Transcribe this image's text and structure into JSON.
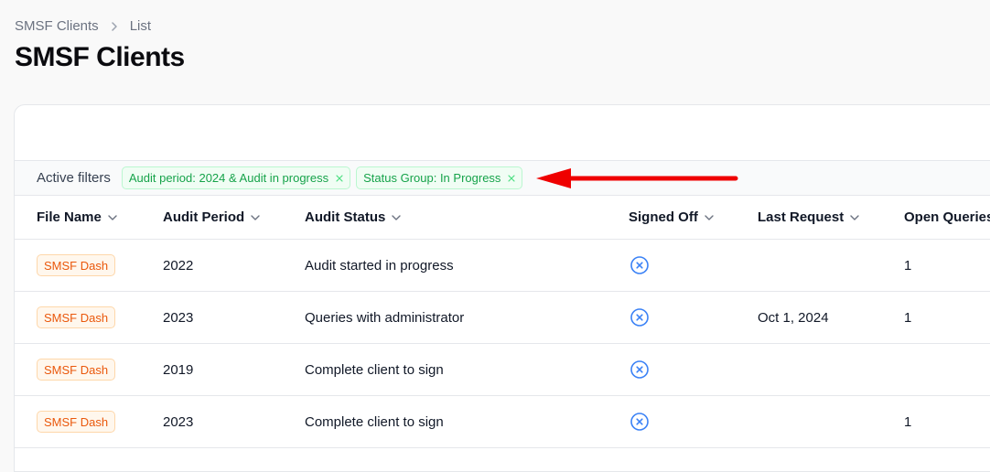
{
  "breadcrumb": {
    "parent": "SMSF Clients",
    "current": "List"
  },
  "page_title": "SMSF Clients",
  "filters": {
    "label": "Active filters",
    "chips": [
      {
        "label": "Audit period: 2024 & Audit in progress"
      },
      {
        "label": "Status Group: In Progress"
      }
    ]
  },
  "table": {
    "columns": [
      "File Name",
      "Audit Period",
      "Audit Status",
      "Signed Off",
      "Last Request",
      "Open Queries"
    ],
    "rows": [
      {
        "file": "SMSF Dash",
        "period": "2022",
        "status": "Audit started in progress",
        "last_request": "",
        "open_queries": "1"
      },
      {
        "file": "SMSF Dash",
        "period": "2023",
        "status": "Queries with administrator",
        "last_request": "Oct 1, 2024",
        "open_queries": "1"
      },
      {
        "file": "SMSF Dash",
        "period": "2019",
        "status": "Complete client to sign",
        "last_request": "",
        "open_queries": ""
      },
      {
        "file": "SMSF Dash",
        "period": "2023",
        "status": "Complete client to sign",
        "last_request": "",
        "open_queries": "1"
      }
    ]
  },
  "colors": {
    "chip_green": "#16a34a",
    "badge_orange": "#ea580c",
    "icon_blue": "#3b82f6",
    "arrow_red": "#ef0000"
  }
}
